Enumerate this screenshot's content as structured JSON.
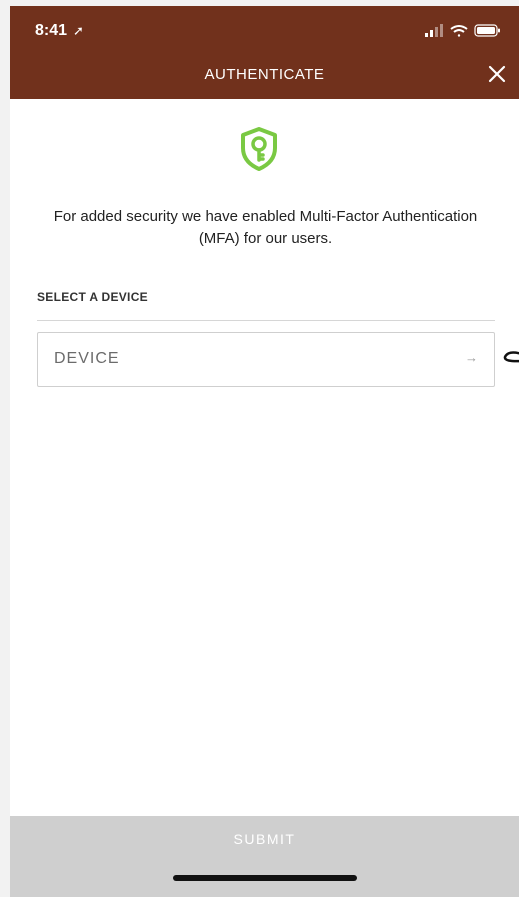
{
  "status_bar": {
    "time": "8:41",
    "location_icon": "location-arrow-icon",
    "signal_icon": "signal-icon",
    "wifi_icon": "wifi-icon",
    "battery_icon": "battery-icon"
  },
  "header": {
    "title": "AUTHENTICATE",
    "close_icon": "close-icon",
    "background": "#71311c"
  },
  "content": {
    "shield_icon": "shield-key-icon",
    "shield_color": "#7ac943",
    "intro_text": "For added security we have enabled Multi-Factor Authentication (MFA) for our users.",
    "section_label": "SELECT A DEVICE",
    "device_select": {
      "label": "DEVICE",
      "arrow_icon": "arrow-right-icon"
    }
  },
  "footer": {
    "submit_label": "SUBMIT",
    "submit_background": "#cfcfcf"
  }
}
